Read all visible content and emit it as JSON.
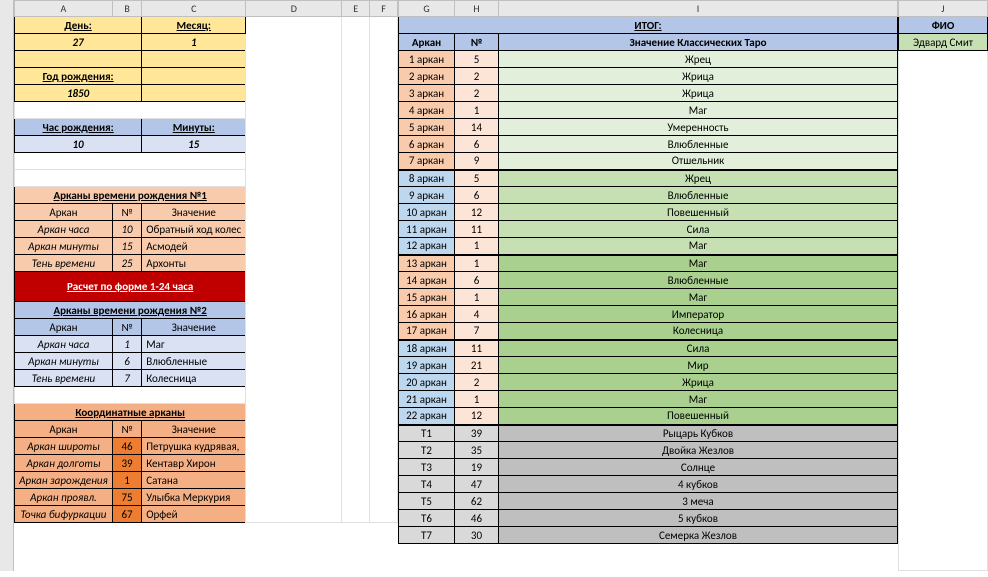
{
  "columns": [
    "A",
    "B",
    "C",
    "D",
    "E",
    "F",
    "G",
    "H",
    "I",
    "J"
  ],
  "left": {
    "day_label": "День:",
    "month_label": "Месяц:",
    "day": "27",
    "month": "1",
    "year_label": "Год рождения:",
    "year": "1850",
    "hour_label": "Час рождения:",
    "minute_label": "Минуты:",
    "hour": "10",
    "minute": "15",
    "block1_title": "Арканы времени рождения №1",
    "cols": {
      "arcan": "Аркан",
      "num": "№",
      "meaning": "Значение"
    },
    "block1_rows": [
      {
        "label": "Аркан часа",
        "num": "10",
        "meaning": "Обратный ход колес"
      },
      {
        "label": "Аркан минуты",
        "num": "15",
        "meaning": "Асмодей"
      },
      {
        "label": "Тень времени",
        "num": "25",
        "meaning": "Архонты"
      }
    ],
    "redbar": "Расчет по форме 1-24 часа",
    "block2_title": "Арканы времени рождения №2",
    "block2_rows": [
      {
        "label": "Аркан часа",
        "num": "1",
        "meaning": "Маг"
      },
      {
        "label": "Аркан минуты",
        "num": "6",
        "meaning": "Влюбленные"
      },
      {
        "label": "Тень времени",
        "num": "7",
        "meaning": "Колесница"
      }
    ],
    "coord_title": "Координатные арканы",
    "coord_rows": [
      {
        "label": "Аркан широты",
        "num": "46",
        "meaning": "Петрушка кудрявая,"
      },
      {
        "label": "Аркан долготы",
        "num": "39",
        "meaning": "Кентавр Хирон"
      },
      {
        "label": "Аркан зарождения",
        "num": "1",
        "meaning": "Сатана"
      },
      {
        "label": "Аркан проявл.",
        "num": "75",
        "meaning": "Улыбка Меркурия"
      },
      {
        "label": "Точка бифуркации",
        "num": "67",
        "meaning": "Орфей"
      }
    ]
  },
  "right": {
    "title": "ИТОГ:",
    "cols": {
      "arcan": "Аркан",
      "num": "№",
      "meaning": "Значение Классических Таро"
    },
    "rows": [
      {
        "label": "1 аркан",
        "num": "5",
        "meaning": "Жрец",
        "style": "lt"
      },
      {
        "label": "2 аркан",
        "num": "2",
        "meaning": "Жрица",
        "style": "lt"
      },
      {
        "label": "3 аркан",
        "num": "2",
        "meaning": "Жрица",
        "style": "lt"
      },
      {
        "label": "4 аркан",
        "num": "1",
        "meaning": "Маг",
        "style": "lt"
      },
      {
        "label": "5 аркан",
        "num": "14",
        "meaning": "Умеренность",
        "style": "lt"
      },
      {
        "label": "6 аркан",
        "num": "6",
        "meaning": "Влюбленные",
        "style": "lt"
      },
      {
        "label": "7 аркан",
        "num": "9",
        "meaning": "Отшельник",
        "style": "lt"
      },
      {
        "label": "8 аркан",
        "num": "5",
        "meaning": "Жрец",
        "style": "md",
        "alt": true
      },
      {
        "label": "9 аркан",
        "num": "6",
        "meaning": "Влюбленные",
        "style": "md",
        "alt": true
      },
      {
        "label": "10 аркан",
        "num": "12",
        "meaning": "Повешенный",
        "style": "md",
        "alt": true
      },
      {
        "label": "11 аркан",
        "num": "11",
        "meaning": "Сила",
        "style": "md",
        "alt": true
      },
      {
        "label": "12 аркан",
        "num": "1",
        "meaning": "Маг",
        "style": "md",
        "alt": true
      },
      {
        "label": "13 аркан",
        "num": "1",
        "meaning": "Маг",
        "style": "dk"
      },
      {
        "label": "14 аркан",
        "num": "6",
        "meaning": "Влюбленные",
        "style": "dk"
      },
      {
        "label": "15 аркан",
        "num": "1",
        "meaning": "Маг",
        "style": "dk"
      },
      {
        "label": "16 аркан",
        "num": "4",
        "meaning": "Император",
        "style": "dk"
      },
      {
        "label": "17 аркан",
        "num": "7",
        "meaning": "Колесница",
        "style": "dk"
      },
      {
        "label": "18 аркан",
        "num": "11",
        "meaning": "Сила",
        "style": "dk",
        "alt": true
      },
      {
        "label": "19 аркан",
        "num": "21",
        "meaning": "Мир",
        "style": "dk",
        "alt": true
      },
      {
        "label": "20 аркан",
        "num": "2",
        "meaning": "Жрица",
        "style": "dk",
        "alt": true
      },
      {
        "label": "21 аркан",
        "num": "1",
        "meaning": "Маг",
        "style": "dk",
        "alt": true
      },
      {
        "label": "22 аркан",
        "num": "12",
        "meaning": "Повешенный",
        "style": "dk",
        "alt": true
      }
    ],
    "trows": [
      {
        "label": "Т1",
        "num": "39",
        "meaning": "Рыцарь Кубков"
      },
      {
        "label": "Т2",
        "num": "35",
        "meaning": "Двойка Жезлов"
      },
      {
        "label": "Т3",
        "num": "19",
        "meaning": "Солнце"
      },
      {
        "label": "Т4",
        "num": "47",
        "meaning": "4 кубков"
      },
      {
        "label": "Т5",
        "num": "62",
        "meaning": "3 меча"
      },
      {
        "label": "Т6",
        "num": "46",
        "meaning": "5 кубков"
      },
      {
        "label": "Т7",
        "num": "30",
        "meaning": "Семерка Жезлов"
      }
    ],
    "fio_label": "ФИО",
    "fio_value": "Эдвард Смит"
  }
}
